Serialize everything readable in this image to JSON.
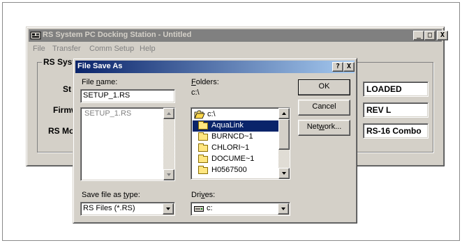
{
  "main_window": {
    "title": "RS System PC Docking Station - Untitled",
    "menu": [
      "File",
      "Transfer",
      "Comm Setup",
      "Help"
    ],
    "caption_buttons": {
      "minimize": "_",
      "maximize": "□",
      "close": "X"
    },
    "group_label": "RS Syst",
    "rows": [
      {
        "label": "St",
        "value": "LOADED"
      },
      {
        "label": "Firmw",
        "value": "REV L"
      },
      {
        "label": "RS Mo",
        "value": "RS-16 Combo"
      }
    ]
  },
  "dialog": {
    "title": "File Save As",
    "caption_buttons": {
      "help": "?",
      "close": "X"
    },
    "file_name_label_pre": "File ",
    "file_name_label_ul": "n",
    "file_name_label_post": "ame:",
    "file_name_value": "SETUP_1.RS",
    "file_list": [
      "SETUP_1.RS"
    ],
    "folders_label_ul": "F",
    "folders_label_post": "olders:",
    "current_folder": "c:\\",
    "folder_list": [
      {
        "name": "c:\\",
        "icon": "open-folder-icon",
        "selected": false
      },
      {
        "name": "AquaLink",
        "icon": "folder-icon",
        "selected": true
      },
      {
        "name": "BURNCD~1",
        "icon": "folder-icon",
        "selected": false
      },
      {
        "name": "CHLORI~1",
        "icon": "folder-icon",
        "selected": false
      },
      {
        "name": "DOCUME~1",
        "icon": "folder-icon",
        "selected": false
      },
      {
        "name": "H0567500",
        "icon": "folder-icon",
        "selected": false
      }
    ],
    "ok_label": "OK",
    "cancel_label": "Cancel",
    "network_label_pre": "Net",
    "network_label_ul": "w",
    "network_label_post": "ork...",
    "save_type_label_pre": "Save file as ",
    "save_type_label_ul": "t",
    "save_type_label_post": "ype:",
    "save_type_value": "RS Files (*.RS)",
    "drives_label_pre": "Dri",
    "drives_label_ul": "v",
    "drives_label_post": "es:",
    "drive_value": "c:"
  },
  "colors": {
    "active_title_start": "#0a246a",
    "active_title_end": "#a6caf0",
    "inactive_title": "#808080",
    "face": "#d4d0c8",
    "selection": "#0a246a"
  }
}
